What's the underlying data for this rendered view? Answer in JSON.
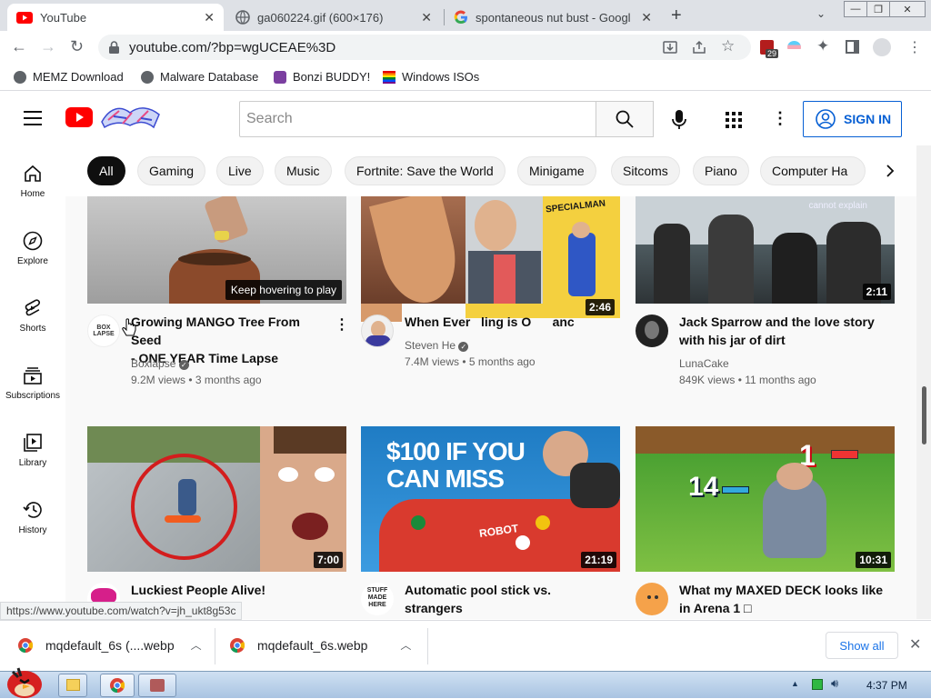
{
  "browser": {
    "tabs": [
      {
        "title": "YouTube",
        "active": true,
        "icon": "youtube-icon"
      },
      {
        "title": "ga060224.gif (600×176)",
        "active": false,
        "icon": "globe-icon"
      },
      {
        "title": "spontaneous nut bust - Googl",
        "active": false,
        "icon": "google-icon"
      }
    ],
    "url": "youtube.com/?bp=wgUCEAE%3D",
    "extension_badge": "29",
    "bookmarks": [
      {
        "label": "MEMZ Download",
        "icon": "globe-icon"
      },
      {
        "label": "Malware Database",
        "icon": "globe-icon"
      },
      {
        "label": "Bonzi BUDDY!",
        "icon": "bonzi-icon"
      },
      {
        "label": "Windows ISOs",
        "icon": "windows-flag-icon"
      }
    ]
  },
  "youtube": {
    "search_placeholder": "Search",
    "sign_in": "SIGN IN",
    "chips": [
      "All",
      "Gaming",
      "Live",
      "Music",
      "Fortnite: Save the World",
      "Minigame",
      "Sitcoms",
      "Piano",
      "Computer Ha"
    ],
    "sidebar": [
      {
        "label": "Home",
        "icon": "home-icon"
      },
      {
        "label": "Explore",
        "icon": "compass-icon"
      },
      {
        "label": "Shorts",
        "icon": "shorts-icon"
      },
      {
        "label": "Subscriptions",
        "icon": "subscriptions-icon"
      },
      {
        "label": "Library",
        "icon": "library-icon"
      },
      {
        "label": "History",
        "icon": "history-icon"
      }
    ],
    "videos": [
      {
        "title_line1": "Growing MANGO Tree From Seed",
        "title_line2": "- ONE YEAR Time Lapse",
        "channel": "Boxlapse",
        "meta": "9.2M views • 3 months ago",
        "duration": "",
        "overlay": "Keep hovering to play",
        "verified": true,
        "avatar_text": "BOX LAPSE"
      },
      {
        "title_line1": "When Ever   ling is O      anc",
        "title_line2": "",
        "channel": "Steven He",
        "meta": "7.4M views • 5 months ago",
        "duration": "2:46",
        "overlay": "",
        "verified": true,
        "thumb_text": "SPECIALMAN"
      },
      {
        "title_line1": "Jack Sparrow and the love story",
        "title_line2": "with his jar of dirt",
        "channel": "LunaCake",
        "meta": "849K views • 11 months ago",
        "duration": "2:11",
        "overlay": "",
        "verified": false,
        "thumb_text": "cannot explain"
      },
      {
        "title_line1": "Luckiest People Alive!",
        "title_line2": "",
        "channel": "",
        "meta": "",
        "duration": "7:00",
        "overlay": "",
        "verified": false
      },
      {
        "title_line1": "Automatic pool stick vs.",
        "title_line2": "strangers",
        "channel": "",
        "meta": "",
        "duration": "21:19",
        "overlay": "",
        "verified": false,
        "thumb_text_1": "$100 IF YOU",
        "thumb_text_2": "CAN MISS",
        "thumb_text_3": "ROBOT",
        "avatar_text": "STUFF MADE HERE"
      },
      {
        "title_line1": "What my MAXED DECK looks like",
        "title_line2": "in Arena 1 □",
        "channel": "",
        "meta": "",
        "duration": "10:31",
        "overlay": "",
        "verified": false,
        "thumb_text_1": "1",
        "thumb_text_2": "14"
      }
    ]
  },
  "status_url": "https://www.youtube.com/watch?v=jh_ukt8g53c",
  "downloads": [
    {
      "name": "mqdefault_6s (....webp"
    },
    {
      "name": "mqdefault_6s.webp"
    }
  ],
  "show_all": "Show all",
  "taskbar": {
    "time": "4:37 PM"
  },
  "colors": {
    "youtube_red": "#ff0000",
    "link_blue": "#065fd4",
    "chip_selected": "#0f0f0f"
  }
}
